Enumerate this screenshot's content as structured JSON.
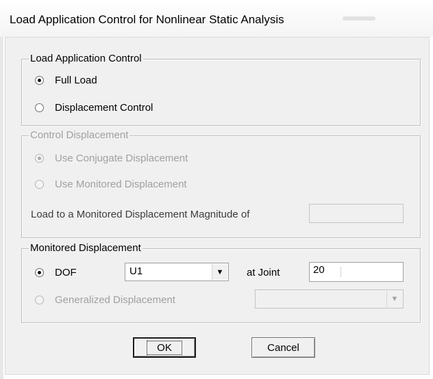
{
  "window": {
    "title": "Load Application Control for Nonlinear Static Analysis"
  },
  "load_application_control": {
    "legend": "Load Application Control",
    "options": [
      {
        "label": "Full Load",
        "selected": true
      },
      {
        "label": "Displacement Control",
        "selected": false
      }
    ]
  },
  "control_displacement": {
    "legend": "Control Displacement",
    "enabled": false,
    "options": [
      {
        "label": "Use Conjugate Displacement",
        "selected": true
      },
      {
        "label": "Use Monitored Displacement",
        "selected": false
      }
    ],
    "magnitude_label": "Load to a Monitored Displacement Magnitude of",
    "magnitude_value": ""
  },
  "monitored_displacement": {
    "legend": "Monitored Displacement",
    "dof_label": "DOF",
    "dof_selected": true,
    "dof_value": "U1",
    "joint_label": "at Joint",
    "joint_value": "20",
    "generalized_label": "Generalized Displacement",
    "generalized_selected": false,
    "generalized_value": ""
  },
  "buttons": {
    "ok": "OK",
    "cancel": "Cancel"
  }
}
